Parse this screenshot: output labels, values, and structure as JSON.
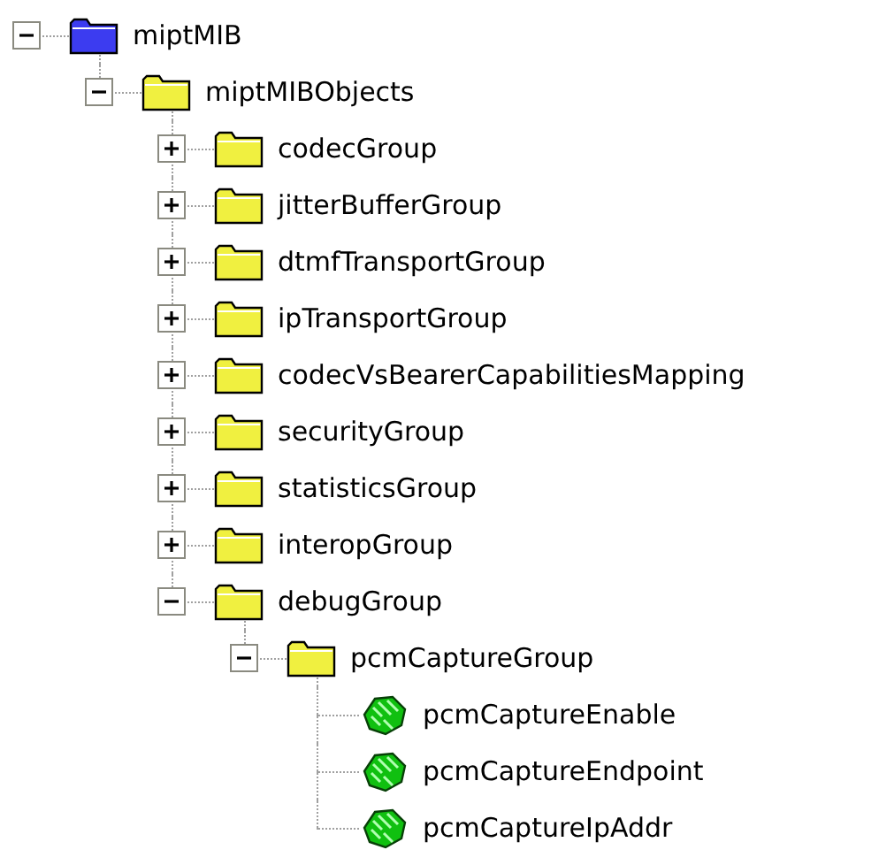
{
  "tree": [
    {
      "label": "miptMIB",
      "kind": "module",
      "expanded": true,
      "children": [
        {
          "label": "miptMIBObjects",
          "kind": "folder",
          "expanded": true,
          "children": [
            {
              "label": "codecGroup",
              "kind": "folder",
              "expanded": false
            },
            {
              "label": "jitterBufferGroup",
              "kind": "folder",
              "expanded": false
            },
            {
              "label": "dtmfTransportGroup",
              "kind": "folder",
              "expanded": false
            },
            {
              "label": "ipTransportGroup",
              "kind": "folder",
              "expanded": false
            },
            {
              "label": "codecVsBearerCapabilitiesMapping",
              "kind": "folder",
              "expanded": false
            },
            {
              "label": "securityGroup",
              "kind": "folder",
              "expanded": false
            },
            {
              "label": "statisticsGroup",
              "kind": "folder",
              "expanded": false
            },
            {
              "label": "interopGroup",
              "kind": "folder",
              "expanded": false
            },
            {
              "label": "debugGroup",
              "kind": "folder",
              "expanded": true,
              "children": [
                {
                  "label": "pcmCaptureGroup",
                  "kind": "folder",
                  "expanded": true,
                  "children": [
                    {
                      "label": "pcmCaptureEnable",
                      "kind": "scalar"
                    },
                    {
                      "label": "pcmCaptureEndpoint",
                      "kind": "scalar"
                    },
                    {
                      "label": "pcmCaptureIpAddr",
                      "kind": "scalar"
                    }
                  ]
                }
              ]
            }
          ]
        }
      ]
    }
  ]
}
